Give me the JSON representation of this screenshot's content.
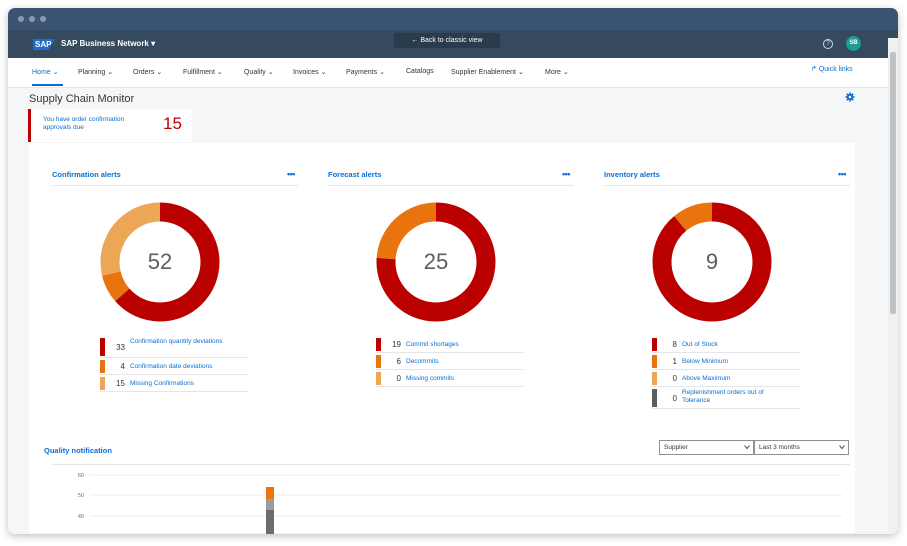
{
  "shell": {
    "logo": "SAP",
    "brand": "SAP Business Network",
    "back_button": "← Back to classic view",
    "help_icon": "?",
    "avatar_initials": "SB"
  },
  "tabs": [
    {
      "label": "Home"
    },
    {
      "label": "Planning"
    },
    {
      "label": "Orders"
    },
    {
      "label": "Fulfillment"
    },
    {
      "label": "Quality"
    },
    {
      "label": "Invoices"
    },
    {
      "label": "Payments"
    },
    {
      "label": "Catalogs"
    },
    {
      "label": "Supplier Enablement"
    },
    {
      "label": "More"
    }
  ],
  "quick_links": "Quick links",
  "page_title": "Supply Chain Monitor",
  "alert": {
    "text": "You have order confirmation approvals due",
    "count": "15"
  },
  "panels": [
    {
      "title": "Confirmation alerts",
      "more": "•••",
      "total": "52",
      "items": [
        {
          "value": 33,
          "label": "Confirmation quantity deviations",
          "color": "#bb0000"
        },
        {
          "value": 4,
          "label": "Confirmation date deviations",
          "color": "#e9730c"
        },
        {
          "value": 15,
          "label": "Missing Confirmations",
          "color": "#eba756"
        }
      ]
    },
    {
      "title": "Forecast alerts",
      "more": "•••",
      "total": "25",
      "items": [
        {
          "value": 19,
          "label": "Commit shortages",
          "color": "#bb0000"
        },
        {
          "value": 6,
          "label": "Decommits",
          "color": "#e9730c"
        },
        {
          "value": 0,
          "label": "Missing commits",
          "color": "#eba756"
        }
      ]
    },
    {
      "title": "Inventory alerts",
      "more": "•••",
      "total": "9",
      "items": [
        {
          "value": 8,
          "label": "Out of Stock",
          "color": "#bb0000"
        },
        {
          "value": 1,
          "label": "Below Minimum",
          "color": "#e9730c"
        },
        {
          "value": 0,
          "label": "Above Maximum",
          "color": "#eba756"
        },
        {
          "value": 0,
          "label": "Replenishment orders out of Tolerance",
          "color": "#5b5e62"
        }
      ]
    }
  ],
  "quality": {
    "title": "Quality notification",
    "filter1": "Supplier",
    "filter2": "Last 3 months",
    "y_ticks": [
      "60",
      "50",
      "40"
    ],
    "colors": {
      "orange": "#e9730c",
      "gray": "#9a9da1",
      "dark": "#6a6d70"
    }
  }
}
